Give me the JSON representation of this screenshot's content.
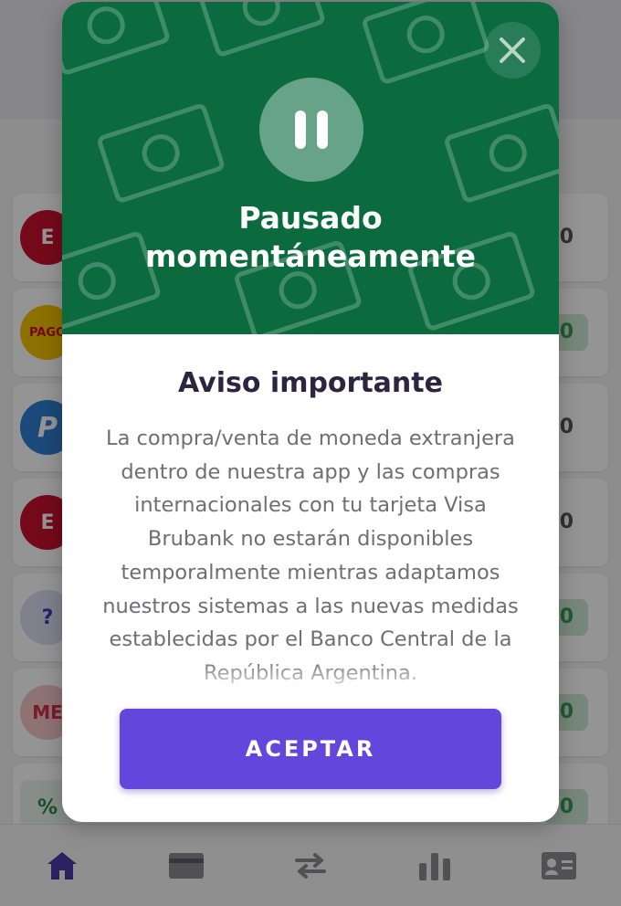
{
  "background": {
    "rows": [
      {
        "logo": "E",
        "logo_color": "#c8102e",
        "amount": "0",
        "amount_style": "plain"
      },
      {
        "logo": "PAGO",
        "logo_color": "#f2c200",
        "amount": "0",
        "amount_style": "green"
      },
      {
        "logo": "P",
        "logo_color": "#2f7fd0",
        "amount": "0",
        "amount_style": "plain"
      },
      {
        "logo": "E",
        "logo_color": "#c8102e",
        "amount": "0",
        "amount_style": "plain"
      },
      {
        "logo": "?",
        "logo_color": "#d9dcf2",
        "amount": "0",
        "amount_style": "green"
      },
      {
        "logo": "ME",
        "logo_color": "#f4c7c7",
        "amount": "0",
        "amount_style": "green"
      },
      {
        "logo": "%",
        "logo_color": "#e9f5ec",
        "amount": "0",
        "amount_style": "green"
      }
    ],
    "nav": [
      {
        "icon": "home-icon",
        "active": true
      },
      {
        "icon": "card-icon",
        "active": false
      },
      {
        "icon": "transfer-icon",
        "active": false
      },
      {
        "icon": "bar-chart-icon",
        "active": false
      },
      {
        "icon": "contact-card-icon",
        "active": false
      }
    ]
  },
  "modal": {
    "hero_title_line1": "Pausado",
    "hero_title_line2": "momentáneamente",
    "notice_title": "Aviso importante",
    "notice_body": "La compra/venta de moneda extranjera dentro de nuestra app y las compras internacionales con tu tarjeta Visa Brubank no estarán disponibles temporalmente mientras adaptamos nuestros sistemas a las nuevas medidas establecidas por el Banco Central de la República Argentina.",
    "accept_label": "ACEPTAR"
  },
  "colors": {
    "hero_green": "#0b6b3f",
    "accent_purple": "#6347dc",
    "title_dark": "#2b2540",
    "body_gray": "#6e6e74"
  }
}
